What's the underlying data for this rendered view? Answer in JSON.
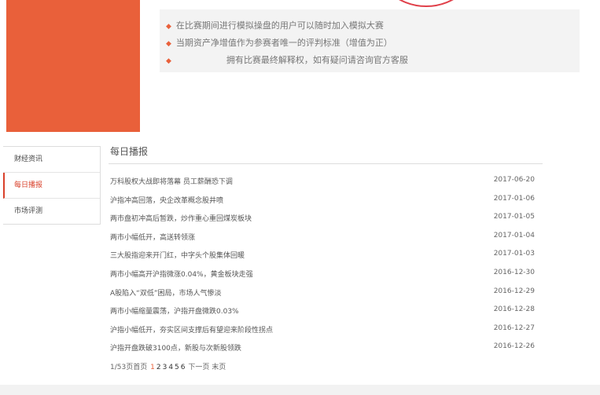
{
  "rules": [
    "在比赛期间进行模拟操盘的用户可以随时加入模拟大赛",
    "当期资产净增值作为参赛者唯一的评判标准（增值为正）",
    "拥有比赛最终解释权，如有疑问请咨询官方客服"
  ],
  "sidebar": [
    {
      "label": "财经资讯"
    },
    {
      "label": "每日播报"
    },
    {
      "label": "市场评测"
    }
  ],
  "section_title": "每日播报",
  "news": [
    {
      "title": "万科股权大战即将落幕 员工薪酬恐下调",
      "date": "2017-06-20"
    },
    {
      "title": "沪指冲高回落，央企改革概念股井喷",
      "date": "2017-01-06"
    },
    {
      "title": "两市盘初冲高后暂跌，炒作重心重回煤炭板块",
      "date": "2017-01-05"
    },
    {
      "title": "两市小幅低开，高送转领涨",
      "date": "2017-01-04"
    },
    {
      "title": "三大股指迎来开门红，中字头个股集体回暖",
      "date": "2017-01-03"
    },
    {
      "title": "两市小幅高开沪指微涨0.04%，黄金板块走强",
      "date": "2016-12-30"
    },
    {
      "title": "A股陷入“双低”困局，市场人气惨淡",
      "date": "2016-12-29"
    },
    {
      "title": "两市小幅缩量震荡，沪指开盘微跌0.03%",
      "date": "2016-12-28"
    },
    {
      "title": "沪指小幅低开，夯实区间支撑后有望迎来阶段性拐点",
      "date": "2016-12-27"
    },
    {
      "title": "沪指开盘跌破3100点，新股与次新股领跌",
      "date": "2016-12-26"
    }
  ],
  "pagination": {
    "info": "1/53页",
    "first": "首页",
    "pages": [
      "1",
      "2",
      "3",
      "4",
      "5",
      "6"
    ],
    "next": "下一页",
    "last": "末页"
  },
  "colors": {
    "accent": "#e9603a",
    "active": "#d9412b"
  }
}
